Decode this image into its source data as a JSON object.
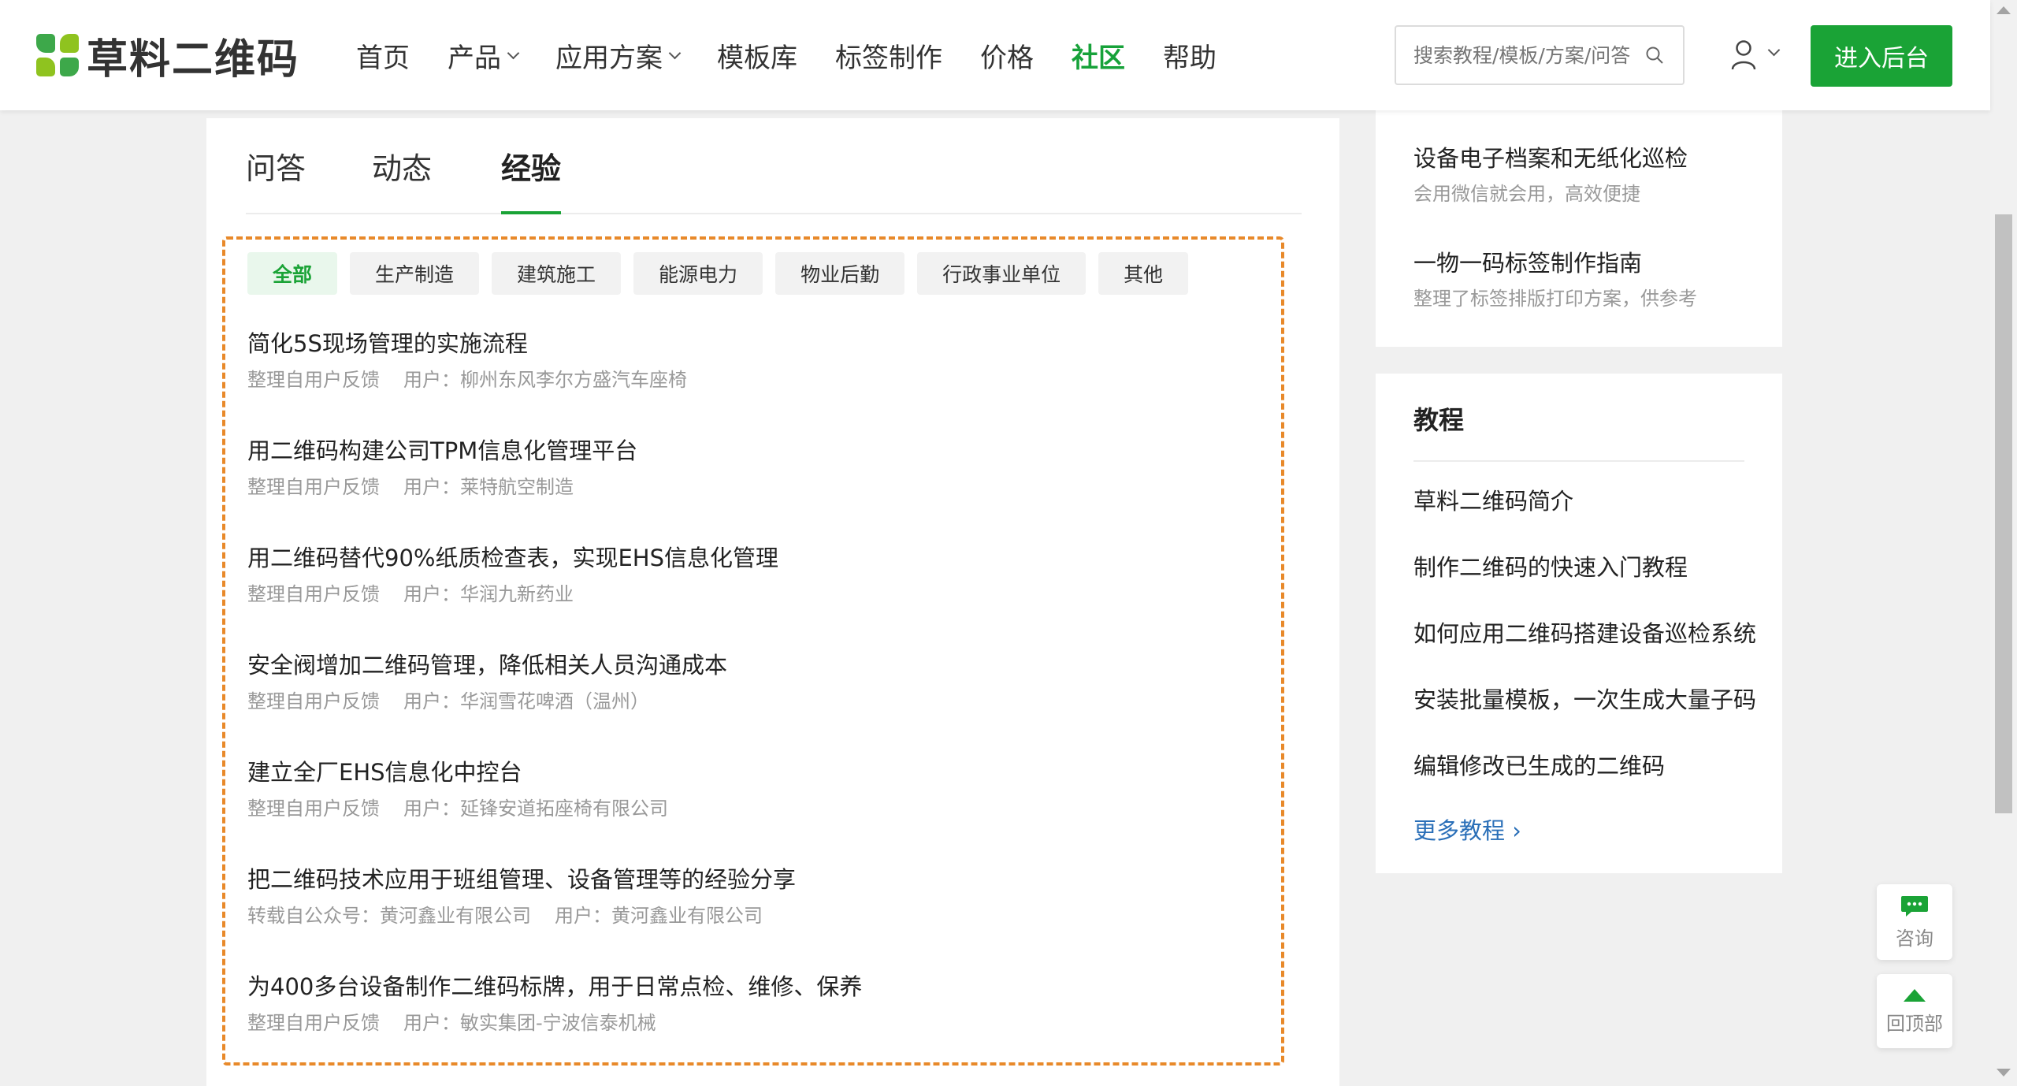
{
  "header": {
    "logo_text": "草料二维码",
    "nav": [
      {
        "label": "首页",
        "dropdown": false,
        "active": false
      },
      {
        "label": "产品",
        "dropdown": true,
        "active": false
      },
      {
        "label": "应用方案",
        "dropdown": true,
        "active": false
      },
      {
        "label": "模板库",
        "dropdown": false,
        "active": false
      },
      {
        "label": "标签制作",
        "dropdown": false,
        "active": false
      },
      {
        "label": "价格",
        "dropdown": false,
        "active": false
      },
      {
        "label": "社区",
        "dropdown": false,
        "active": true
      },
      {
        "label": "帮助",
        "dropdown": false,
        "active": false
      }
    ],
    "search_placeholder": "搜索教程/模板/方案/问答",
    "cta_label": "进入后台"
  },
  "main": {
    "tabs": [
      "问答",
      "动态",
      "经验"
    ],
    "active_tab": "经验",
    "filters": [
      "全部",
      "生产制造",
      "建筑施工",
      "能源电力",
      "物业后勤",
      "行政事业单位",
      "其他"
    ],
    "active_filter": "全部",
    "articles": [
      {
        "title": "简化5S现场管理的实施流程",
        "source": "整理自用户反馈",
        "user": "用户：柳州东风李尔方盛汽车座椅"
      },
      {
        "title": "用二维码构建公司TPM信息化管理平台",
        "source": "整理自用户反馈",
        "user": "用户：莱特航空制造"
      },
      {
        "title": "用二维码替代90%纸质检查表，实现EHS信息化管理",
        "source": "整理自用户反馈",
        "user": "用户：华润九新药业"
      },
      {
        "title": "安全阀增加二维码管理，降低相关人员沟通成本",
        "source": "整理自用户反馈",
        "user": "用户：华润雪花啤酒（温州）"
      },
      {
        "title": "建立全厂EHS信息化中控台",
        "source": "整理自用户反馈",
        "user": "用户：延锋安道拓座椅有限公司"
      },
      {
        "title": "把二维码技术应用于班组管理、设备管理等的经验分享",
        "source": "转载自公众号：黄河鑫业有限公司",
        "user": "用户：黄河鑫业有限公司"
      },
      {
        "title": "为400多台设备制作二维码标牌，用于日常点检、维修、保养",
        "source": "整理自用户反馈",
        "user": "用户：敏实集团-宁波信泰机械"
      }
    ]
  },
  "sidebar": {
    "features": [
      {
        "title": "设备电子档案和无纸化巡检",
        "sub": "会用微信就会用，高效便捷"
      },
      {
        "title": "一物一码标签制作指南",
        "sub": "整理了标签排版打印方案，供参考"
      }
    ],
    "tutorial_heading": "教程",
    "tutorials": [
      "草料二维码简介",
      "制作二维码的快速入门教程",
      "如何应用二维码搭建设备巡检系统",
      "安装批量模板，一次生成大量子码",
      "编辑修改已生成的二维码"
    ],
    "more_label": "更多教程 ›"
  },
  "float": {
    "consult_label": "咨询",
    "top_label": "回顶部"
  },
  "colors": {
    "brand_green": "#1aa336",
    "highlight_border": "#e8892a",
    "link_blue": "#2a6fb8"
  }
}
